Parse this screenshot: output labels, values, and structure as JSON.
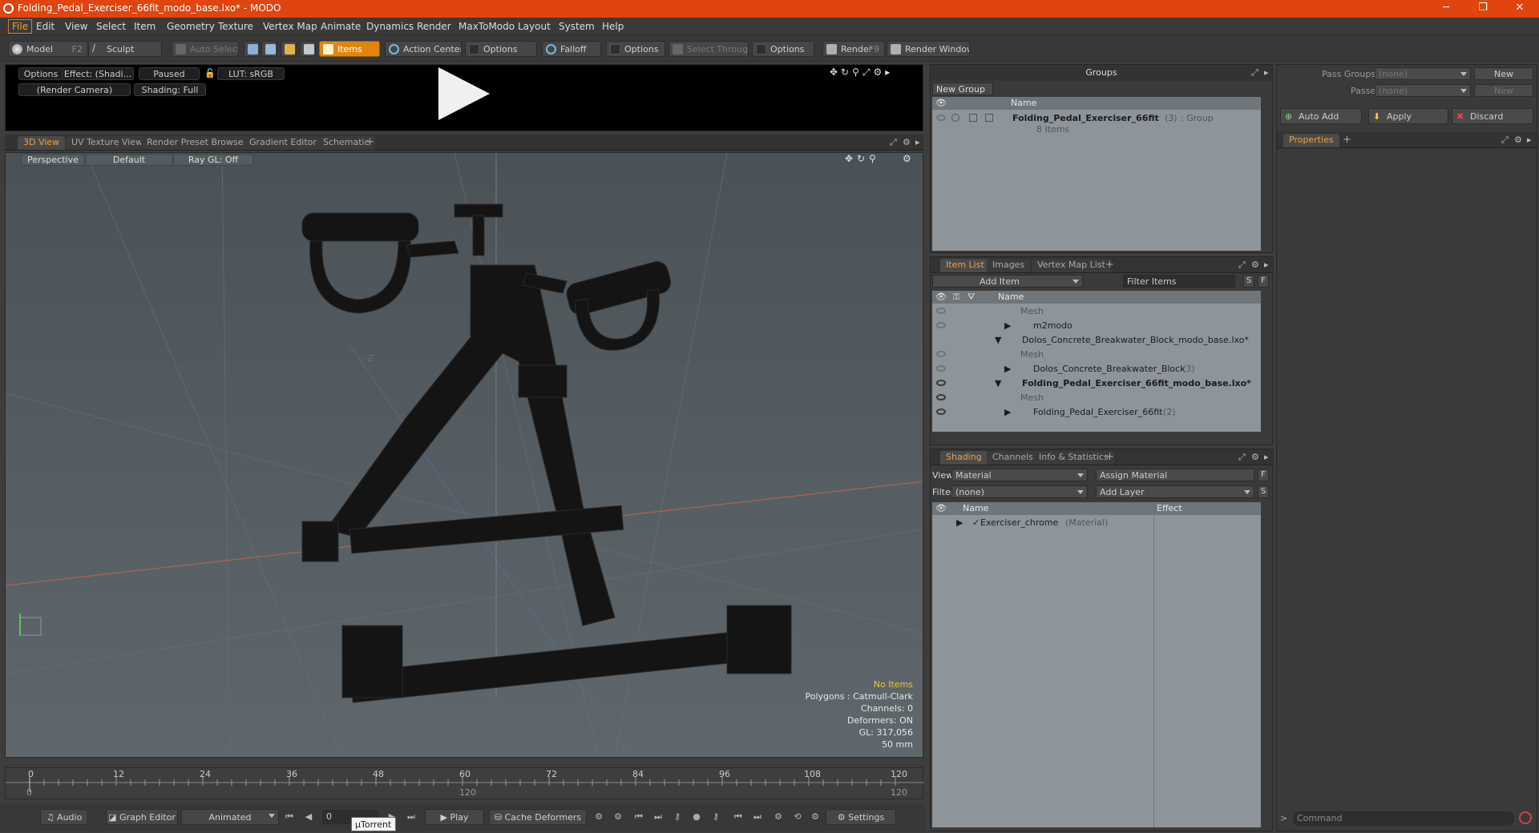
{
  "window": {
    "title": "Folding_Pedal_Exerciser_66fit_modo_base.lxo* - MODO",
    "minimize": "─",
    "restore": "❐",
    "close": "✕"
  },
  "menu": [
    "File",
    "Edit",
    "View",
    "Select",
    "Item",
    "Geometry",
    "Texture",
    "Vertex Map",
    "Animate",
    "Dynamics",
    "Render",
    "MaxToModo",
    "Layout",
    "System",
    "Help"
  ],
  "toolbar": {
    "model": "Model",
    "model_key": "F2",
    "sculpt": "Sculpt",
    "auto_select": "Auto Select",
    "items": "Items",
    "action_center": "Action Center",
    "options1": "Options",
    "falloff": "Falloff",
    "options2": "Options",
    "select_through": "Select Through",
    "options3": "Options",
    "render": "Render",
    "render_key": "F9",
    "render_window": "Render Window"
  },
  "preview": {
    "options": "Options",
    "effect": "Effect: (Shadi...",
    "paused": "Paused",
    "lut": "LUT: sRGB",
    "camera": "(Render Camera)",
    "shading": "Shading: Full"
  },
  "viewport_tabs": [
    "3D View",
    "UV Texture View",
    "Render Preset Browser",
    "Gradient Editor",
    "Schematic"
  ],
  "viewport": {
    "projection": "Perspective",
    "style": "Default",
    "raygl": "Ray GL: Off",
    "axis_label": "-Z",
    "stats": {
      "selection": "No Items",
      "polygons": "Polygons : Catmull-Clark",
      "channels": "Channels: 0",
      "deformers": "Deformers: ON",
      "gl": "GL: 317,056",
      "size": "50 mm"
    }
  },
  "timeline": {
    "ticks": [
      "0",
      "12",
      "24",
      "36",
      "48",
      "60",
      "72",
      "84",
      "96",
      "108",
      "120"
    ],
    "range_start": "0",
    "range_mid": "120",
    "range_end": "120"
  },
  "bottombar": {
    "audio": "Audio",
    "graph_editor": "Graph Editor",
    "animated": "Animated",
    "frame": "0",
    "play": "Play",
    "cache_deformers": "Cache Deformers",
    "settings": "Settings",
    "tooltip": "µTorrent"
  },
  "groups": {
    "title": "Groups",
    "new_group": "New Group",
    "col_name": "Name",
    "item_name": "Folding_Pedal_Exerciser_66fit",
    "item_count": "(3)",
    "item_type": ": Group",
    "item_sub": "8 Items"
  },
  "item_list": {
    "tabs": [
      "Item List",
      "Images",
      "Vertex Map List"
    ],
    "add_item": "Add Item",
    "filter_items": "Filter Items",
    "btn_s": "S",
    "btn_f": "F",
    "col_name": "Name",
    "rows": [
      {
        "label": "Mesh",
        "count": ""
      },
      {
        "label": "m2modo",
        "count": ""
      },
      {
        "label": "Dolos_Concrete_Breakwater_Block_modo_base.lxo*",
        "count": ""
      },
      {
        "label": "Mesh",
        "count": ""
      },
      {
        "label": "Dolos_Concrete_Breakwater_Block",
        "count": "(3)"
      },
      {
        "label": "Folding_Pedal_Exerciser_66fit_modo_base.lxo*",
        "count": ""
      },
      {
        "label": "Mesh",
        "count": ""
      },
      {
        "label": "Folding_Pedal_Exerciser_66fit",
        "count": "(2)"
      }
    ]
  },
  "shading": {
    "tabs": [
      "Shading",
      "Channels",
      "Info & Statistics"
    ],
    "view_label": "View",
    "view_value": "Material",
    "assign_material": "Assign Material",
    "filter_label": "Filter",
    "filter_value": "(none)",
    "add_layer": "Add Layer",
    "btn_f": "F",
    "btn_s": "S",
    "col_name": "Name",
    "col_effect": "Effect",
    "row_name": "Exerciser_chrome",
    "row_type": "(Material)"
  },
  "properties_panel": {
    "pass_groups_label": "Pass Groups",
    "pass_groups_value": "(none)",
    "passes_label": "Passes",
    "passes_value": "(none)",
    "new1": "New",
    "new2": "New",
    "auto_add": "Auto Add",
    "apply": "Apply",
    "discard": "Discard",
    "tab": "Properties",
    "command_placeholder": "Command"
  }
}
